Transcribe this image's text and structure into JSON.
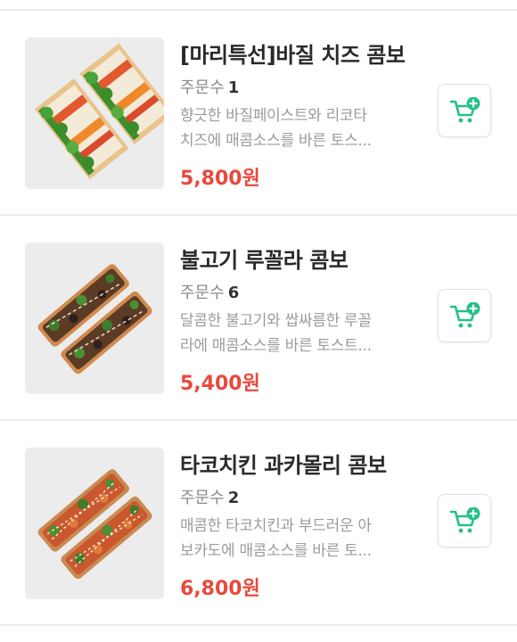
{
  "order_count_label": "주문수",
  "cart_icon": "add-to-cart-icon",
  "colors": {
    "price": "#e8493d",
    "cart_icon": "#25c08a",
    "thumb_bg": "#ececec"
  },
  "items": [
    {
      "title": "[마리특선]바질 치즈 콤보",
      "order_count": "1",
      "desc_line1": "향긋한 바질페이스트와 리코타",
      "desc_line2": "치즈에 매콤소스를 바른 토스...",
      "price": "5,800원",
      "image": "basil-cheese-sandwich-image"
    },
    {
      "title": "불고기 루꼴라 콤보",
      "order_count": "6",
      "desc_line1": "달콤한 불고기와 쌉싸름한 루꼴",
      "desc_line2": "라에 매콤소스를 바른 토스트...",
      "price": "5,400원",
      "image": "bulgogi-arugula-toast-image"
    },
    {
      "title": "타코치킨 과카몰리 콤보",
      "order_count": "2",
      "desc_line1": "매콤한 타코치킨과 부드러운 아",
      "desc_line2": "보카도에 매콤소스를 바른 토...",
      "price": "6,800원",
      "image": "taco-chicken-guacamole-toast-image"
    }
  ]
}
